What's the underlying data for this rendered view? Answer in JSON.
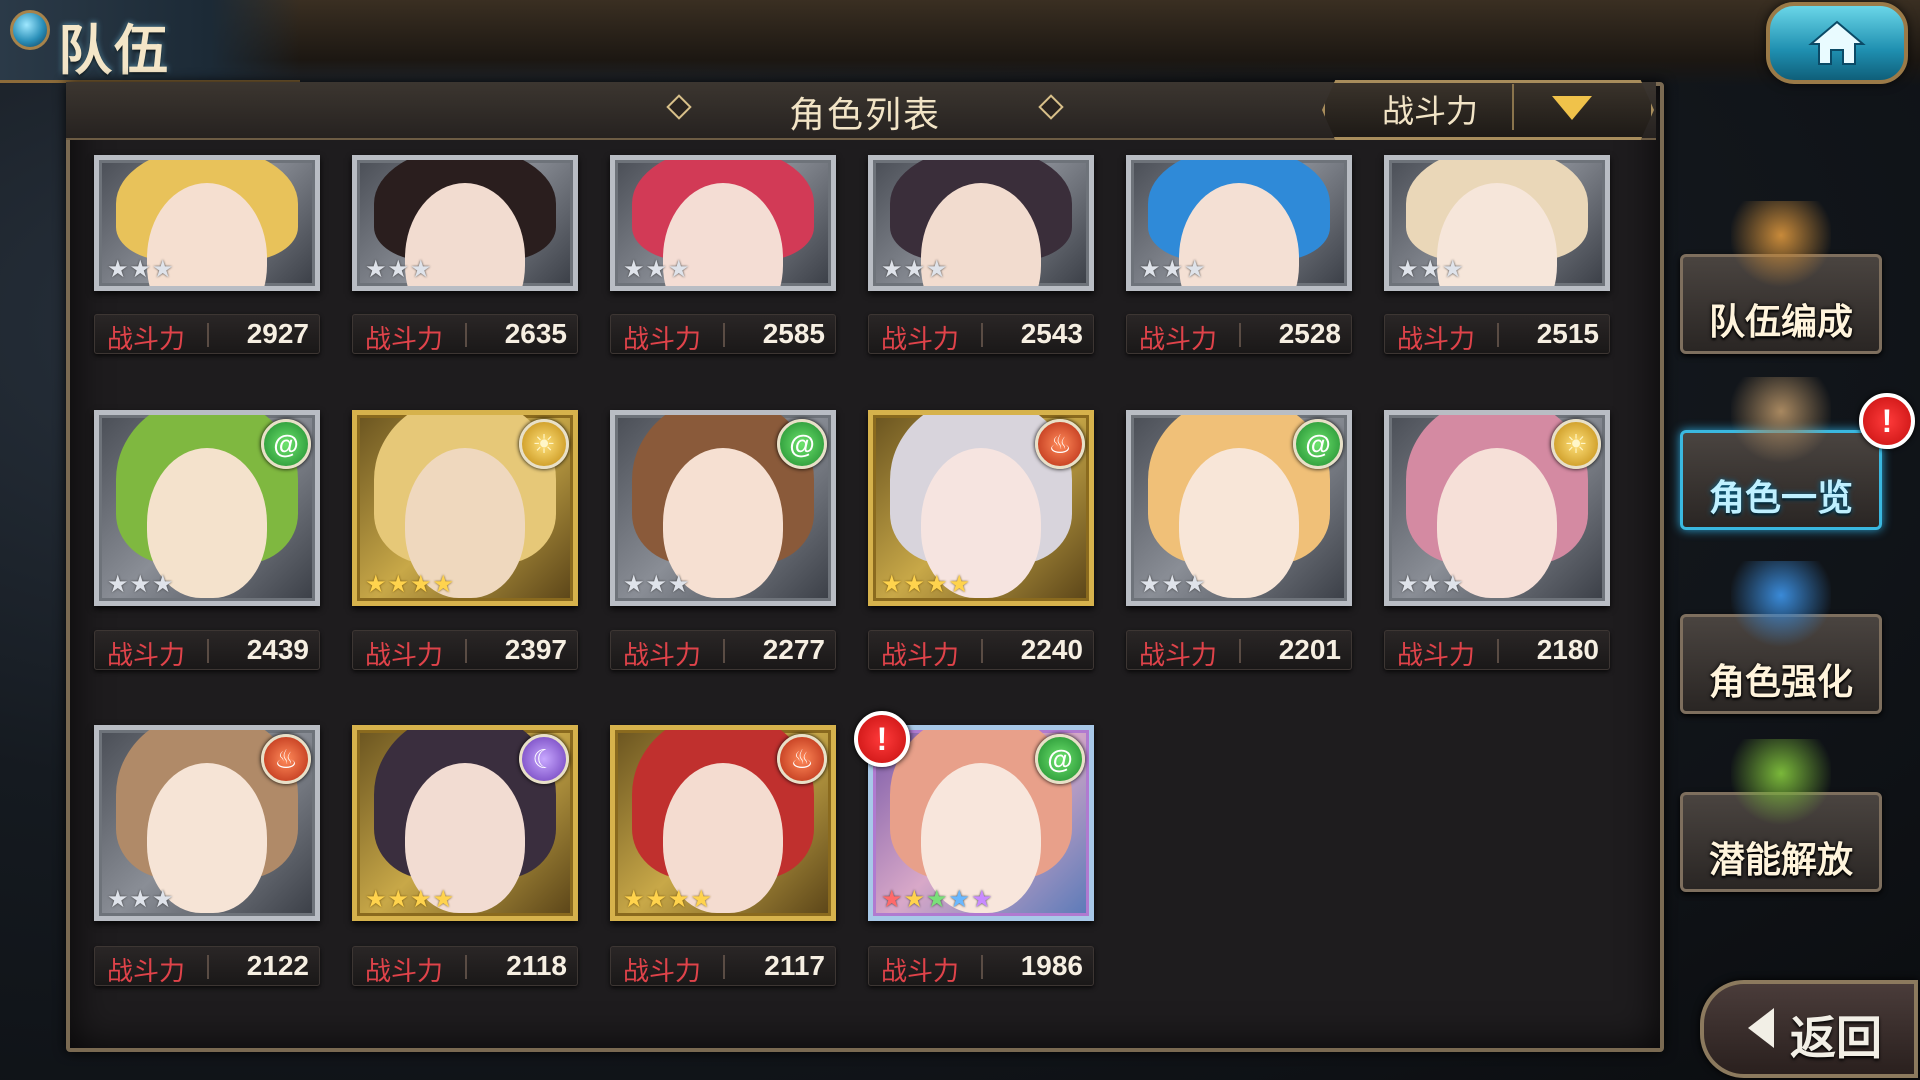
{
  "header": {
    "title": "队伍",
    "list_title": "角色列表",
    "sort_label": "战斗力"
  },
  "power_label": "战斗力",
  "characters": [
    {
      "power": "2927",
      "frame": "silver",
      "stars": 3,
      "element": "",
      "hair": "#e8c25a",
      "skin": "#f5dfd0"
    },
    {
      "power": "2635",
      "frame": "silver",
      "stars": 3,
      "element": "",
      "hair": "#2a1e1e",
      "skin": "#f2dcd0"
    },
    {
      "power": "2585",
      "frame": "silver",
      "stars": 3,
      "element": "",
      "hair": "#d23a56",
      "skin": "#f4ddd4"
    },
    {
      "power": "2543",
      "frame": "silver",
      "stars": 3,
      "element": "",
      "hair": "#3a2e3a",
      "skin": "#f2dccf"
    },
    {
      "power": "2528",
      "frame": "silver",
      "stars": 3,
      "element": "",
      "hair": "#2f8ad8",
      "skin": "#f4e0d4"
    },
    {
      "power": "2515",
      "frame": "silver",
      "stars": 3,
      "element": "",
      "hair": "#ead7b8",
      "skin": "#f6e6da"
    },
    {
      "power": "2439",
      "frame": "silver",
      "stars": 3,
      "element": "wind",
      "hair": "#7fb840",
      "skin": "#f4e2cc"
    },
    {
      "power": "2397",
      "frame": "gold",
      "stars": 4,
      "element": "sun",
      "hair": "#e6c878",
      "skin": "#efd8be"
    },
    {
      "power": "2277",
      "frame": "silver",
      "stars": 3,
      "element": "wind",
      "hair": "#8a5a3a",
      "skin": "#f6e0d2"
    },
    {
      "power": "2240",
      "frame": "gold",
      "stars": 4,
      "element": "fire",
      "hair": "#d8d4dc",
      "skin": "#f6e4e0"
    },
    {
      "power": "2201",
      "frame": "silver",
      "stars": 3,
      "element": "wind",
      "hair": "#f0c078",
      "skin": "#f8e6d8"
    },
    {
      "power": "2180",
      "frame": "silver",
      "stars": 3,
      "element": "sun",
      "hair": "#d48aa2",
      "skin": "#f6e0d8"
    },
    {
      "power": "2122",
      "frame": "silver",
      "stars": 3,
      "element": "fire",
      "hair": "#b08a68",
      "skin": "#f6e4d6"
    },
    {
      "power": "2118",
      "frame": "gold",
      "stars": 4,
      "element": "moon",
      "hair": "#3a2e3e",
      "skin": "#f2dcd2"
    },
    {
      "power": "2117",
      "frame": "gold",
      "stars": 4,
      "element": "fire",
      "hair": "#c0302e",
      "skin": "#f4dcd0"
    },
    {
      "power": "1986",
      "frame": "rainbow",
      "stars": 5,
      "element": "wind",
      "hair": "#e8a08a",
      "skin": "#f8e6dc",
      "alert": "!"
    }
  ],
  "side_menu": [
    {
      "label": "队伍编成",
      "active": false,
      "icon": "team-formation-icon",
      "color": "#c88a3a"
    },
    {
      "label": "角色一览",
      "active": true,
      "icon": "character-book-icon",
      "color": "#a88860",
      "alert": "!"
    },
    {
      "label": "角色强化",
      "active": false,
      "icon": "enhance-crystal-icon",
      "color": "#3a8ad8"
    },
    {
      "label": "潜能解放",
      "active": false,
      "icon": "potential-orb-icon",
      "color": "#7ab83a"
    }
  ],
  "back_label": "返回"
}
